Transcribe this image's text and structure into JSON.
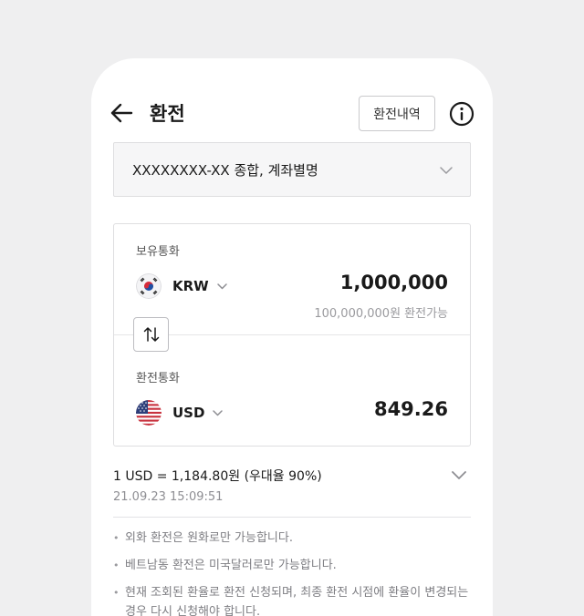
{
  "header": {
    "title": "환전",
    "history_label": "환전내역",
    "back_icon": "arrow-left-icon",
    "info_icon": "info-circle-icon"
  },
  "account": {
    "label": "XXXXXXXX-XX 종합, 계좌별명"
  },
  "holding": {
    "section_label": "보유통화",
    "currency_code": "KRW",
    "flag": "south-korea-flag-icon",
    "amount": "1,000,000",
    "available_text": "100,000,000원 환전가능"
  },
  "target": {
    "section_label": "환전통화",
    "currency_code": "USD",
    "flag": "usa-flag-icon",
    "amount": "849.26"
  },
  "rate": {
    "text": "1 USD = 1,184.80원 (우대율 90%)",
    "timestamp": "21.09.23 15:09:51"
  },
  "notes": [
    "외화 환전은 원화로만 가능합니다.",
    "베트남동 환전은 미국달러로만 가능합니다.",
    "현재 조회된 환율로 환전 신청되며, 최종 환전 시점에 환율이 변경되는 경우 다시 신청해야 합니다."
  ],
  "colors": {
    "background": "#efeff0",
    "card": "#ffffff",
    "text_primary": "#1a1a1a",
    "text_muted": "#9a9a9e"
  }
}
